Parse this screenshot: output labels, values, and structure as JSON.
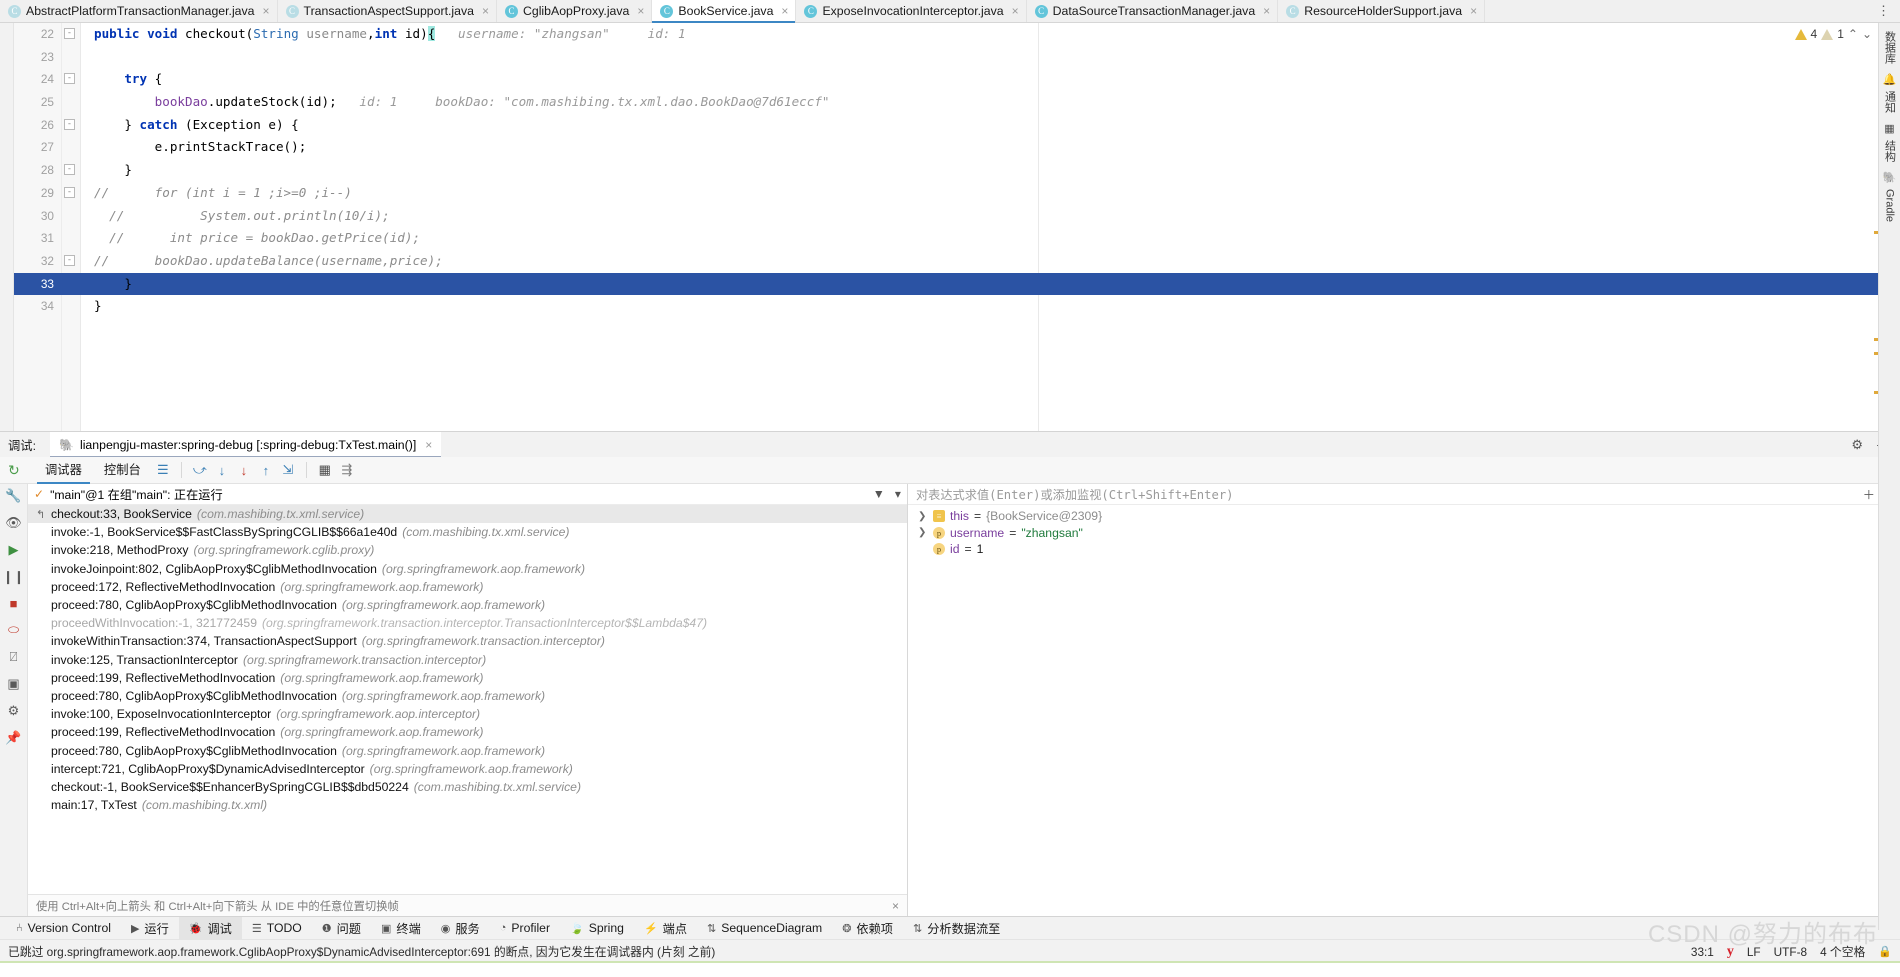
{
  "tabs": [
    {
      "label": "AbstractPlatformTransactionManager.java",
      "active": false,
      "dim": true
    },
    {
      "label": "TransactionAspectSupport.java",
      "active": false,
      "dim": true
    },
    {
      "label": "CglibAopProxy.java",
      "active": false,
      "dim": false
    },
    {
      "label": "BookService.java",
      "active": true,
      "dim": false
    },
    {
      "label": "ExposeInvocationInterceptor.java",
      "active": false,
      "dim": false
    },
    {
      "label": "DataSourceTransactionManager.java",
      "active": false,
      "dim": false
    },
    {
      "label": "ResourceHolderSupport.java",
      "active": false,
      "dim": true
    }
  ],
  "editor": {
    "inspection": {
      "warn_count": "4",
      "weak_count": "1",
      "up": "⌃",
      "down": "⌄"
    },
    "lines": [
      {
        "num": "22",
        "fold": "-",
        "segments": [
          {
            "t": "public ",
            "c": "kw"
          },
          {
            "t": "void ",
            "c": "kw"
          },
          {
            "t": "checkout",
            "c": "plain"
          },
          {
            "t": "(",
            "c": "plain"
          },
          {
            "t": "String ",
            "c": "ty"
          },
          {
            "t": "username",
            "c": "pm"
          },
          {
            "t": ",",
            "c": "plain"
          },
          {
            "t": "int ",
            "c": "kw"
          },
          {
            "t": "id",
            "c": "plain"
          },
          {
            "t": ")",
            "c": "plain"
          },
          {
            "t": "{",
            "c": "brace-hl"
          },
          {
            "t": "   username: \"zhangsan\"     id: 1",
            "c": "hint"
          }
        ]
      },
      {
        "num": "23",
        "fold": "",
        "segments": []
      },
      {
        "num": "24",
        "fold": "-",
        "segments": [
          {
            "t": "    ",
            "c": "plain"
          },
          {
            "t": "try",
            "c": "kw"
          },
          {
            "t": " {",
            "c": "plain"
          }
        ]
      },
      {
        "num": "25",
        "fold": "",
        "segments": [
          {
            "t": "        ",
            "c": "plain"
          },
          {
            "t": "bookDao",
            "c": "mth"
          },
          {
            "t": ".updateStock(id);",
            "c": "plain"
          },
          {
            "t": "   id: 1     bookDao: \"com.mashibing.tx.xml.dao.BookDao@7d61eccf\"",
            "c": "hint"
          }
        ]
      },
      {
        "num": "26",
        "fold": "-",
        "segments": [
          {
            "t": "    } ",
            "c": "plain"
          },
          {
            "t": "catch",
            "c": "kw"
          },
          {
            "t": " (Exception e) {",
            "c": "plain"
          }
        ]
      },
      {
        "num": "27",
        "fold": "",
        "segments": [
          {
            "t": "        e.printStackTrace();",
            "c": "plain"
          }
        ]
      },
      {
        "num": "28",
        "fold": "-",
        "segments": [
          {
            "t": "    }",
            "c": "plain"
          }
        ]
      },
      {
        "num": "29",
        "fold": "-",
        "segments": [
          {
            "t": "//",
            "c": "cmt"
          },
          {
            "t": "      for (int i = 1 ;i>=0 ;i--)",
            "c": "cmt"
          }
        ]
      },
      {
        "num": "30",
        "fold": "",
        "segments": [
          {
            "t": "  //",
            "c": "cmt"
          },
          {
            "t": "          System.out.println(10/i);",
            "c": "cmt"
          }
        ]
      },
      {
        "num": "31",
        "fold": "",
        "segments": [
          {
            "t": "  //",
            "c": "cmt"
          },
          {
            "t": "      int price = bookDao.getPrice(id);",
            "c": "cmt"
          }
        ]
      },
      {
        "num": "32",
        "fold": "-",
        "segments": [
          {
            "t": "//",
            "c": "cmt"
          },
          {
            "t": "      bookDao.updateBalance(username,price);",
            "c": "cmt"
          }
        ]
      },
      {
        "num": "33",
        "fold": "",
        "current": true,
        "segments": [
          {
            "t": "    }",
            "c": "plain"
          }
        ]
      },
      {
        "num": "34",
        "fold": "",
        "segments": [
          {
            "t": "}",
            "c": "plain"
          }
        ]
      }
    ]
  },
  "right_strip": {
    "items": [
      {
        "icon": "",
        "label": "数据库"
      },
      {
        "icon": "bell-icon",
        "label": "通知"
      },
      {
        "icon": "structure-icon",
        "label": "结构"
      },
      {
        "icon": "elephant-icon",
        "label": "Gradle"
      }
    ]
  },
  "debug": {
    "label": "调试:",
    "session_tab": "lianpengju-master:spring-debug [:spring-debug:TxTest.main()]",
    "close": "×",
    "header_icons": {
      "settings": "⚙",
      "minimize": "—"
    },
    "toolbar": {
      "restart_icon": "rerun-icon",
      "tabs": [
        {
          "label": "调试器",
          "selected": true
        },
        {
          "label": "控制台",
          "selected": false
        }
      ],
      "icons": [
        "layout-icon",
        "step-over-icon",
        "step-into-icon",
        "force-step-into-icon",
        "step-out-icon",
        "run-to-cursor-icon",
        "evaluate-icon",
        "mute-icon"
      ]
    },
    "left_rail_icons": [
      "wrench-icon",
      "eye-icon",
      "resume-icon",
      "pause-icon",
      "stop-icon",
      "mute-breakpoints-icon",
      "breakpoints-icon",
      "camera-icon",
      "settings-icon",
      "pin-icon"
    ],
    "thread": {
      "status": "\"main\"@1 在组\"main\": 正在运行",
      "filter_icon": "filter-icon",
      "dropdown_icon": "▾"
    },
    "frames": [
      {
        "name": "checkout:33, BookService",
        "pkg": "(com.mashibing.tx.xml.service)",
        "selected": true,
        "faded": false
      },
      {
        "name": "invoke:-1, BookService$$FastClassBySpringCGLIB$$66a1e40d",
        "pkg": "(com.mashibing.tx.xml.service)",
        "selected": false,
        "faded": false
      },
      {
        "name": "invoke:218, MethodProxy",
        "pkg": "(org.springframework.cglib.proxy)",
        "selected": false,
        "faded": false
      },
      {
        "name": "invokeJoinpoint:802, CglibAopProxy$CglibMethodInvocation",
        "pkg": "(org.springframework.aop.framework)",
        "selected": false,
        "faded": false
      },
      {
        "name": "proceed:172, ReflectiveMethodInvocation",
        "pkg": "(org.springframework.aop.framework)",
        "selected": false,
        "faded": false
      },
      {
        "name": "proceed:780, CglibAopProxy$CglibMethodInvocation",
        "pkg": "(org.springframework.aop.framework)",
        "selected": false,
        "faded": false
      },
      {
        "name": "proceedWithInvocation:-1, 321772459",
        "pkg": "(org.springframework.transaction.interceptor.TransactionInterceptor$$Lambda$47)",
        "selected": false,
        "faded": true
      },
      {
        "name": "invokeWithinTransaction:374, TransactionAspectSupport",
        "pkg": "(org.springframework.transaction.interceptor)",
        "selected": false,
        "faded": false
      },
      {
        "name": "invoke:125, TransactionInterceptor",
        "pkg": "(org.springframework.transaction.interceptor)",
        "selected": false,
        "faded": false
      },
      {
        "name": "proceed:199, ReflectiveMethodInvocation",
        "pkg": "(org.springframework.aop.framework)",
        "selected": false,
        "faded": false
      },
      {
        "name": "proceed:780, CglibAopProxy$CglibMethodInvocation",
        "pkg": "(org.springframework.aop.framework)",
        "selected": false,
        "faded": false
      },
      {
        "name": "invoke:100, ExposeInvocationInterceptor",
        "pkg": "(org.springframework.aop.interceptor)",
        "selected": false,
        "faded": false
      },
      {
        "name": "proceed:199, ReflectiveMethodInvocation",
        "pkg": "(org.springframework.aop.framework)",
        "selected": false,
        "faded": false
      },
      {
        "name": "proceed:780, CglibAopProxy$CglibMethodInvocation",
        "pkg": "(org.springframework.aop.framework)",
        "selected": false,
        "faded": false
      },
      {
        "name": "intercept:721, CglibAopProxy$DynamicAdvisedInterceptor",
        "pkg": "(org.springframework.aop.framework)",
        "selected": false,
        "faded": false
      },
      {
        "name": "checkout:-1, BookService$$EnhancerBySpringCGLIB$$dbd50224",
        "pkg": "(com.mashibing.tx.xml.service)",
        "selected": false,
        "faded": false
      },
      {
        "name": "main:17, TxTest",
        "pkg": "(com.mashibing.tx.xml)",
        "selected": false,
        "faded": false
      }
    ],
    "frames_footer": "使用 Ctrl+Alt+向上箭头 和 Ctrl+Alt+向下箭头 从 IDE 中的任意位置切换帧",
    "frames_footer_close": "×",
    "watch": {
      "placeholder": "对表达式求值(Enter)或添加监视(Ctrl+Shift+Enter)",
      "add_icon": "＋",
      "dropdown_icon": "▾"
    },
    "variables": [
      {
        "expandable": true,
        "badge": "≡",
        "badge_kind": "list",
        "name": "this",
        "eq": "=",
        "value": "{BookService@2309}",
        "value_kind": "obj"
      },
      {
        "expandable": true,
        "badge": "p",
        "badge_kind": "field",
        "name": "username",
        "eq": "=",
        "value": "\"zhangsan\"",
        "value_kind": "str"
      },
      {
        "expandable": false,
        "badge": "p",
        "badge_kind": "field",
        "name": "id",
        "eq": "=",
        "value": "1",
        "value_kind": "num"
      }
    ]
  },
  "tool_windows": [
    {
      "label": "Version Control",
      "icon": "branch-icon",
      "active": false
    },
    {
      "label": "运行",
      "icon": "run-icon",
      "active": false
    },
    {
      "label": "调试",
      "icon": "debug-icon",
      "active": true
    },
    {
      "label": "TODO",
      "icon": "todo-icon",
      "active": false
    },
    {
      "label": "问题",
      "icon": "problems-icon",
      "active": false
    },
    {
      "label": "终端",
      "icon": "terminal-icon",
      "active": false
    },
    {
      "label": "服务",
      "icon": "services-icon",
      "active": false
    },
    {
      "label": "Profiler",
      "icon": "profiler-icon",
      "active": false
    },
    {
      "label": "Spring",
      "icon": "spring-icon",
      "active": false
    },
    {
      "label": "端点",
      "icon": "endpoints-icon",
      "active": false
    },
    {
      "label": "SequenceDiagram",
      "icon": "sequence-icon",
      "active": false
    },
    {
      "label": "依赖项",
      "icon": "dependencies-icon",
      "active": false
    },
    {
      "label": "分析数据流至",
      "icon": "dataflow-icon",
      "active": false
    }
  ],
  "status": {
    "message": "已跳过 org.springframework.aop.framework.CglibAopProxy$DynamicAdvisedInterceptor:691 的断点, 因为它发生在调试器内 (片刻 之前)",
    "caret": "33:1",
    "warn_icon": "y",
    "line_sep": "LF",
    "encoding": "UTF-8",
    "indent": "4 个空格",
    "lock_icon": "lock-icon"
  },
  "watermark": "CSDN @努力的布布",
  "colors": {
    "accent": "#3c87c4",
    "selection": "#2b53a4",
    "keyword": "#0033b3",
    "string": "#207b3d",
    "hint": "#9a9a9a"
  }
}
